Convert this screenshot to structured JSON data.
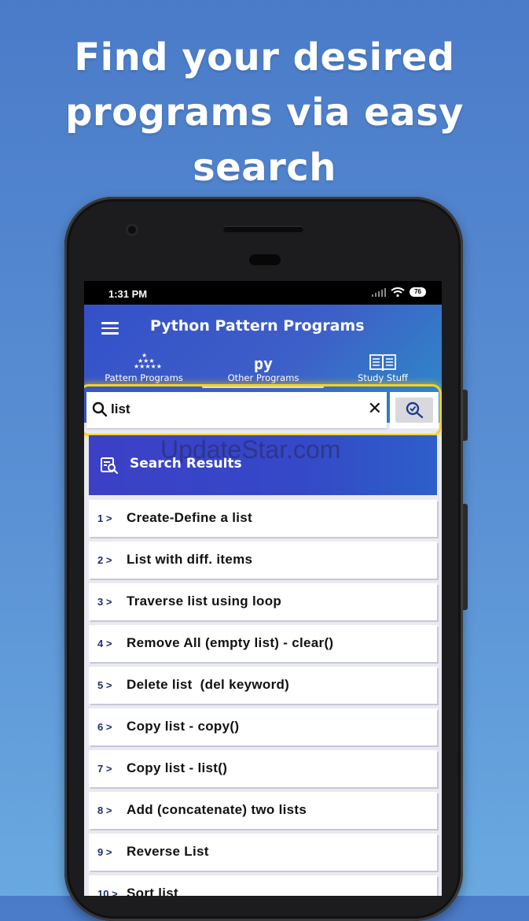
{
  "headline": {
    "line1": "Find your desired",
    "line2": "programs via easy",
    "line3": "search"
  },
  "status_bar": {
    "time": "1:31 PM",
    "battery": "76"
  },
  "app_bar": {
    "title": "Python Pattern Programs",
    "tabs": [
      {
        "label": "Pattern Programs",
        "icon": "star-pyramid-icon"
      },
      {
        "label": "Other Programs",
        "icon": "py-icon",
        "glyph": "py"
      },
      {
        "label": "Study Stuff",
        "icon": "open-book-icon"
      }
    ]
  },
  "search": {
    "value": "list",
    "clear_glyph": "✕",
    "highlight_color": "#f4d31f"
  },
  "results": {
    "header": "Search Results",
    "items": [
      {
        "num": "1 >",
        "label": "Create-Define a list"
      },
      {
        "num": "2 >",
        "label": "List with diff. items"
      },
      {
        "num": "3 >",
        "label": "Traverse list using loop"
      },
      {
        "num": "4 >",
        "label": "Remove All (empty list) - clear()"
      },
      {
        "num": "5 >",
        "label": "Delete list  (del keyword)"
      },
      {
        "num": "6 >",
        "label": "Copy list - copy()"
      },
      {
        "num": "7 >",
        "label": "Copy list - list()"
      },
      {
        "num": "8 >",
        "label": "Add (concatenate) two lists"
      },
      {
        "num": "9 >",
        "label": "Reverse List"
      },
      {
        "num": "10 >",
        "label": "Sort list"
      }
    ]
  },
  "watermark": "UpdateStar.com",
  "colors": {
    "background": "#4a7bc9",
    "appbar": "#3450c9",
    "results_header": "#3c40c6",
    "number_text": "#1d2f6f"
  }
}
